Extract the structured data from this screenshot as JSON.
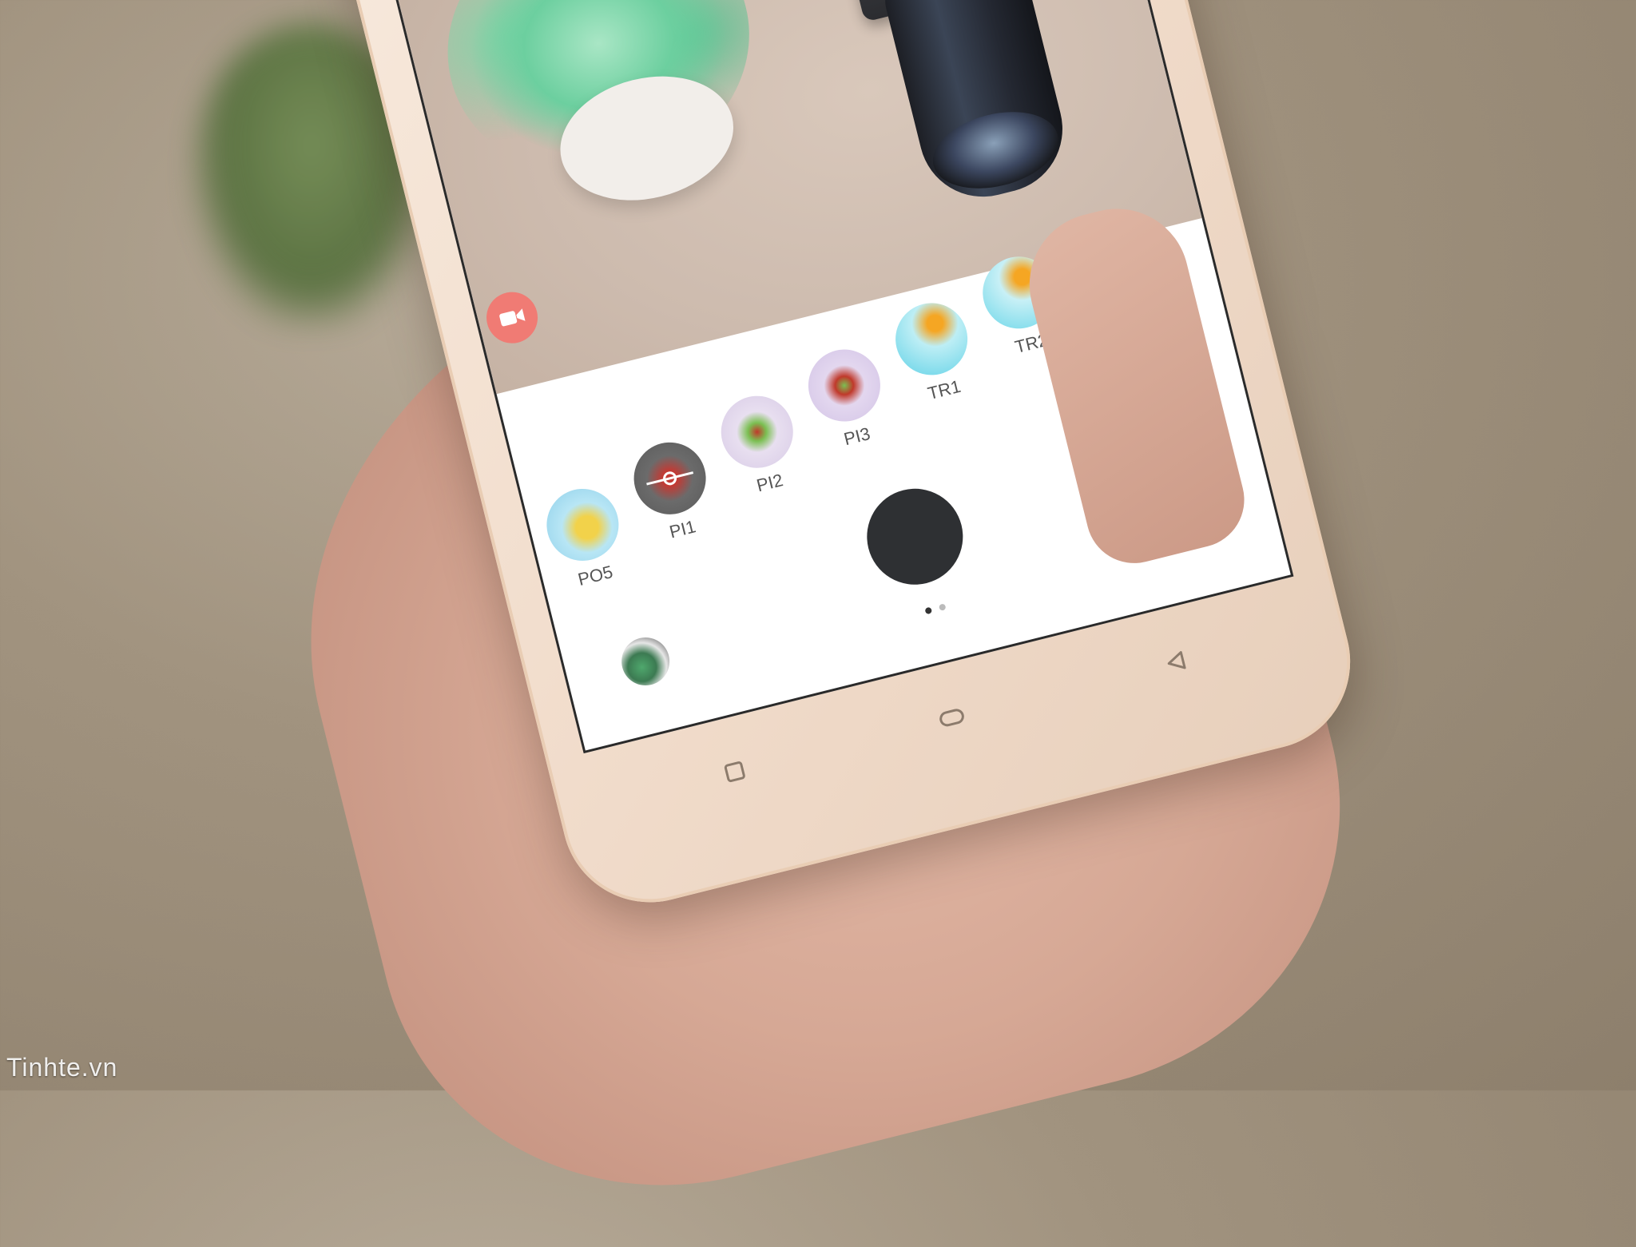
{
  "camera_app": {
    "filters": [
      {
        "label": "PO5",
        "colors": [
          "#b8e6f5",
          "#f2d24a"
        ]
      },
      {
        "label": "PI1",
        "colors": [
          "#6b6b6b",
          "#c23a34"
        ]
      },
      {
        "label": "PI2",
        "colors": [
          "#e8dff0",
          "#c0392b"
        ]
      },
      {
        "label": "PI3",
        "colors": [
          "#e3d7ef",
          "#7bbf52"
        ]
      },
      {
        "label": "TR1",
        "colors": [
          "#5fd1e6",
          "#f5a623"
        ]
      },
      {
        "label": "TR2",
        "colors": [
          "#6ad6e8",
          "#f5a623"
        ]
      }
    ],
    "selected_filter": "PI1",
    "page_indicator": {
      "total": 2,
      "active": 1
    }
  },
  "watermark": "Tinhte.vn",
  "colors": {
    "shutter": "#2e3033",
    "record": "#f07b74",
    "phone_body": "#f3e2d3"
  }
}
